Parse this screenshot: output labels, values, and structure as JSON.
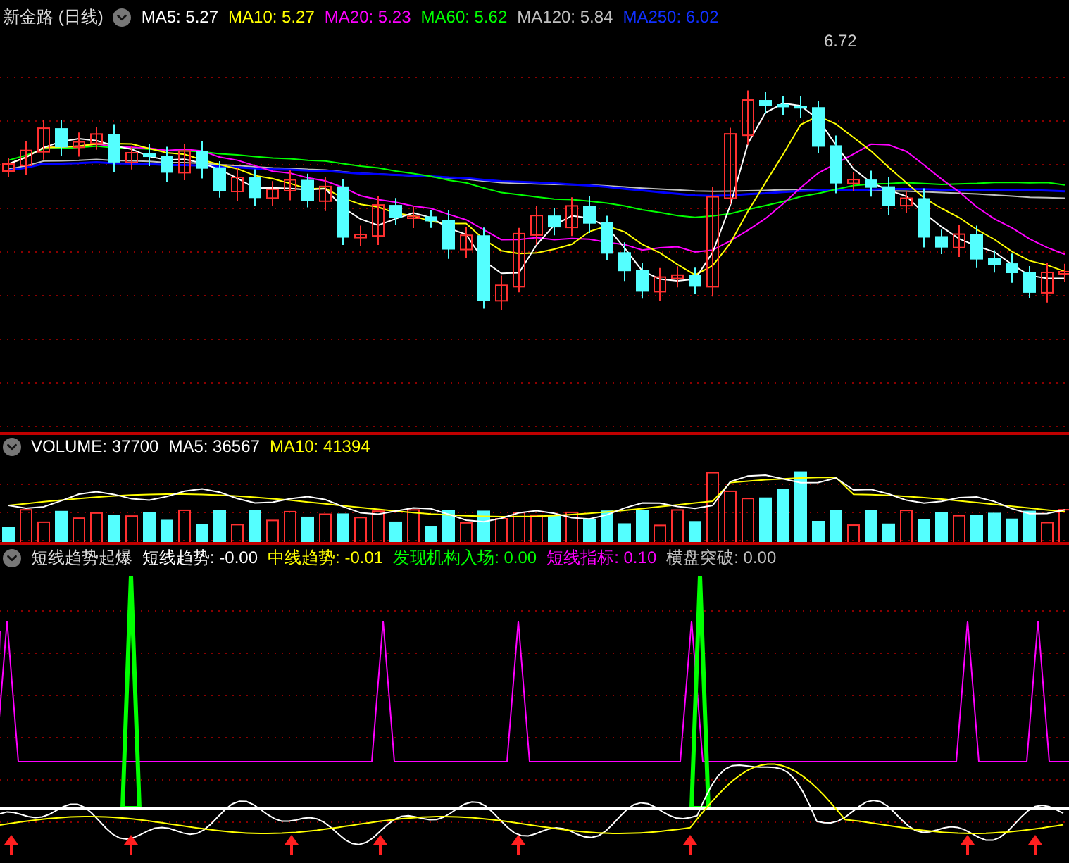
{
  "main_panel": {
    "title": "新金路 (日线)",
    "legend": [
      {
        "label": "MA5: 5.27",
        "color": "#ffffff"
      },
      {
        "label": "MA10: 5.27",
        "color": "#ffff00"
      },
      {
        "label": "MA20: 5.23",
        "color": "#ff00ff"
      },
      {
        "label": "MA60: 5.62",
        "color": "#00ff00"
      },
      {
        "label": "MA120: 5.84",
        "color": "#c0c0c0"
      },
      {
        "label": "MA250: 6.02",
        "color": "#1030ff"
      }
    ],
    "high_label": "6.72"
  },
  "volume_panel": {
    "legend": [
      {
        "label": "VOLUME: 37700",
        "color": "#ffffff"
      },
      {
        "label": "MA5: 36567",
        "color": "#ffffff"
      },
      {
        "label": "MA10: 41394",
        "color": "#ffff00"
      }
    ]
  },
  "indicator_panel": {
    "title": "短线趋势起爆",
    "legend": [
      {
        "label": "短线趋势: -0.00",
        "color": "#ffffff"
      },
      {
        "label": "中线趋势: -0.01",
        "color": "#ffff00"
      },
      {
        "label": "发现机构入场: 0.00",
        "color": "#00ff00"
      },
      {
        "label": "短线指标: 0.10",
        "color": "#ff00ff"
      },
      {
        "label": "横盘突破: 0.00",
        "color": "#c0c0c0"
      }
    ]
  }
}
